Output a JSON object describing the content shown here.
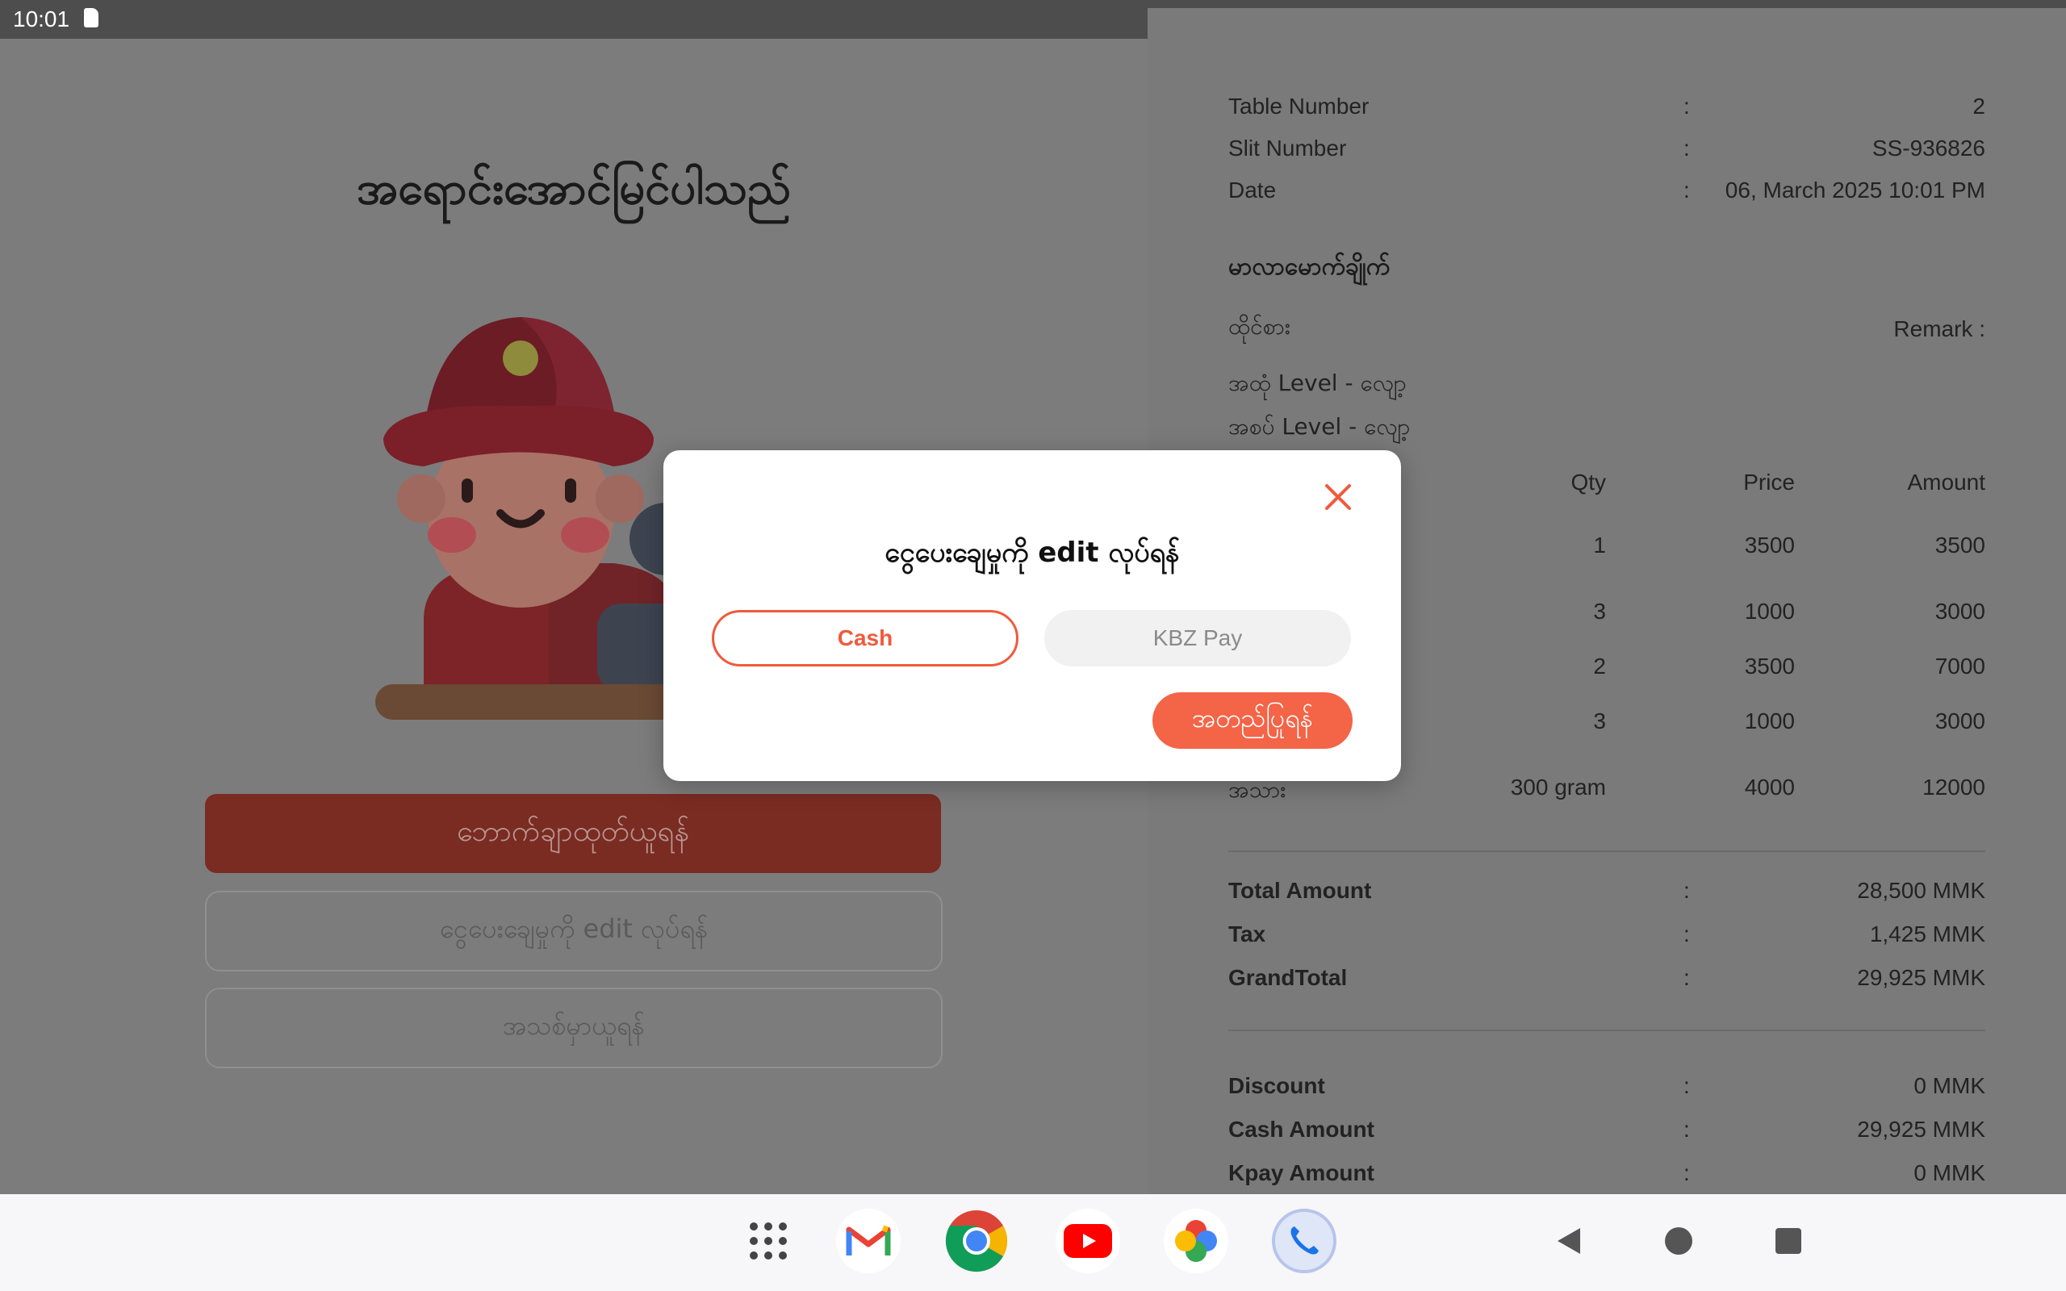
{
  "status_bar": {
    "time": "10:01"
  },
  "left_panel": {
    "success_title": "အရောင်းအောင်မြင်ပါသည်",
    "print_button": "ဘောက်ချာထုတ်ယူရန်",
    "edit_payment_button": "ငွေပေးချေမှုကို edit လုပ်ရန်",
    "new_order_button": "အသစ်မှာယူရန်"
  },
  "receipt": {
    "table_number_label": "Table Number",
    "table_number": "2",
    "slip_number_label": "Slit Number",
    "slip_number": "SS-936826",
    "date_label": "Date",
    "date": "06, March 2025 10:01 PM",
    "colon": ":",
    "section_title": "မာလာမောက်ချိုက်",
    "dining_type": "ထိုင်စား",
    "remark_label": "Remark :",
    "spice_level": "အထုံ Level - လျော့",
    "numbing_level": "အစပ် Level - လျော့",
    "columns": {
      "qty": "Qty",
      "price": "Price",
      "amount": "Amount"
    },
    "items": [
      {
        "name": "",
        "qty": "1",
        "price": "3500",
        "amount": "3500"
      },
      {
        "name": "",
        "qty": "3",
        "price": "1000",
        "amount": "3000"
      },
      {
        "name": "",
        "qty": "2",
        "price": "3500",
        "amount": "7000"
      },
      {
        "name": "",
        "qty": "3",
        "price": "1000",
        "amount": "3000"
      },
      {
        "name": "အသား",
        "qty": "300 gram",
        "price": "4000",
        "amount": "12000"
      }
    ],
    "total_amount_label": "Total Amount",
    "total_amount": "28,500 MMK",
    "tax_label": "Tax",
    "tax": "1,425 MMK",
    "grand_total_label": "GrandTotal",
    "grand_total": "29,925 MMK",
    "discount_label": "Discount",
    "discount": "0 MMK",
    "cash_amount_label": "Cash Amount",
    "cash_amount": "29,925 MMK",
    "kpay_amount_label": "Kpay Amount",
    "kpay_amount": "0 MMK"
  },
  "dialog": {
    "title": "ငွေပေးချေမှုကို edit လုပ်ရန်",
    "cash_option": "Cash",
    "kbz_option": "KBZ Pay",
    "confirm_button": "အတည်ပြုရန်",
    "accent_color": "#f46447"
  },
  "nav_bar": {
    "apps": [
      "app-drawer-icon",
      "gmail-icon",
      "chrome-icon",
      "youtube-icon",
      "photos-icon",
      "phone-icon"
    ]
  }
}
